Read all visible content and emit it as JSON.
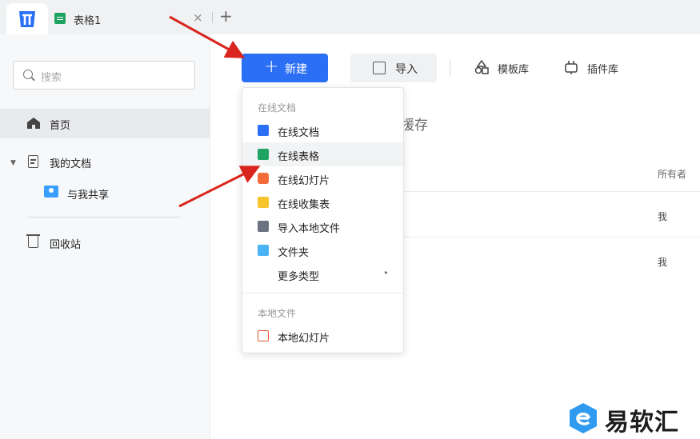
{
  "tabs": {
    "doc_title": "表格1",
    "close_glyph": "×",
    "add_glyph": "+"
  },
  "sidebar": {
    "search_placeholder": "搜索",
    "home": "首页",
    "my_docs": "我的文档",
    "shared_with_me": "与我共享",
    "recycle_bin": "回收站",
    "caret": "▼"
  },
  "toolbar": {
    "new_plus": "+",
    "new_label": "新建",
    "import_label": "导入",
    "templates_label": "模板库",
    "plugins_label": "插件库"
  },
  "main": {
    "partial_heading": "援存",
    "owner_header": "所有者",
    "rows": [
      {
        "owner": "我"
      },
      {
        "owner": "我"
      }
    ]
  },
  "dropdown": {
    "online_header": "在线文档",
    "items": [
      {
        "label": "在线文档",
        "icon": "doc-icon",
        "color": "#2b6ff5"
      },
      {
        "label": "在线表格",
        "icon": "sheet-icon",
        "color": "#1ea362"
      },
      {
        "label": "在线幻灯片",
        "icon": "slides-icon",
        "color": "#f36b3b"
      },
      {
        "label": "在线收集表",
        "icon": "form-icon",
        "color": "#f7c52b"
      },
      {
        "label": "导入本地文件",
        "icon": "upload-icon",
        "color": "#6b7280"
      },
      {
        "label": "文件夹",
        "icon": "folder-icon",
        "color": "#4ab3f4"
      },
      {
        "label": "更多类型",
        "icon": "",
        "color": ""
      }
    ],
    "local_header": "本地文件",
    "local_items": [
      {
        "label": "本地幻灯片",
        "icon": "ppt-icon",
        "color": "#e8572e"
      }
    ],
    "submenu_arrow": "▸"
  },
  "watermark": {
    "text": "易软汇"
  },
  "colors": {
    "accent": "#2b6ff5",
    "annotation_arrow": "#d9251d"
  }
}
